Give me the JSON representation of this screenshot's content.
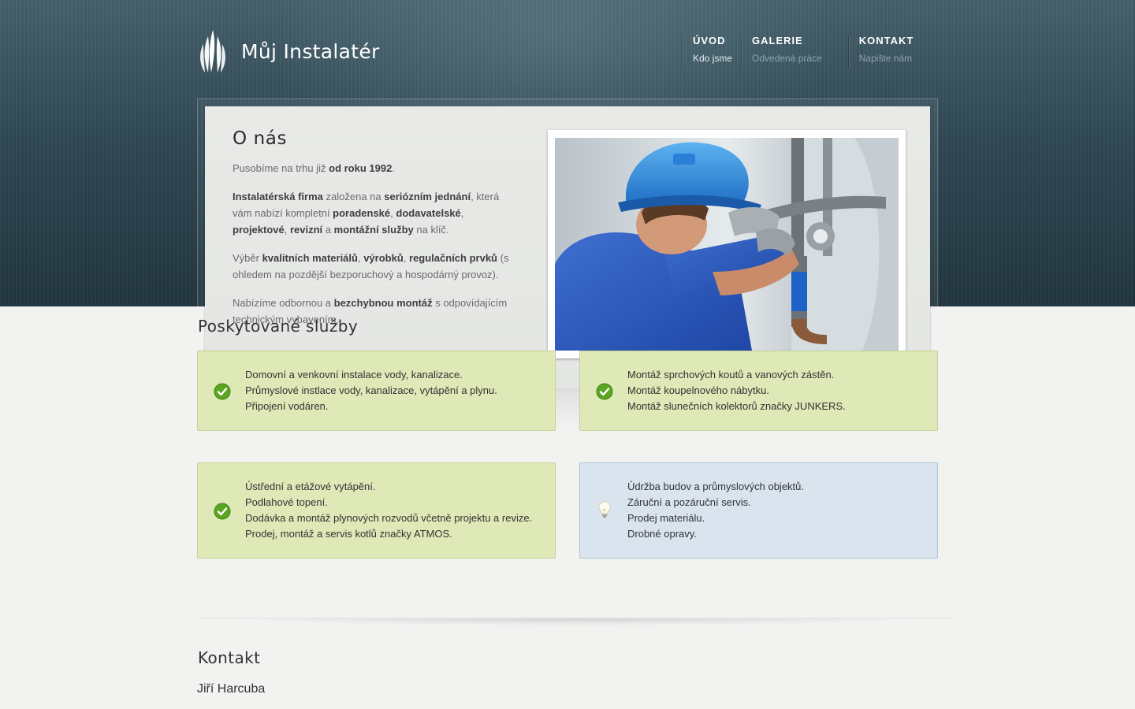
{
  "header": {
    "logo_text": "Můj Instalatér",
    "nav": [
      {
        "title": "ÚVOD",
        "sub": "Kdo jsme"
      },
      {
        "title": "GALERIE",
        "sub": "Odvedená práce"
      },
      {
        "title": "KONTAKT",
        "sub": "Napište nám"
      }
    ]
  },
  "about": {
    "title": "O nás",
    "p1": {
      "t1": "Pusobíme na trhu již ",
      "b1": "od roku 1992",
      "t2": "."
    },
    "p2": {
      "b1": "Instalatérská firma",
      "t1": " založena na ",
      "b2": "seriózním jednání",
      "t2": ", která vám nabízí kompletní ",
      "b3": "poradenské",
      "t3": ", ",
      "b4": "dodavatelské",
      "t4": ", ",
      "b5": "projektové",
      "t5": ", ",
      "b6": "revizní",
      "t6": " a ",
      "b7": "montážní služby",
      "t7": " na klíč."
    },
    "p3": {
      "t0": "Výběr ",
      "b1": "kvalitních materiálů",
      "t1": ", ",
      "b2": "výrobků",
      "t2": ", ",
      "b3": "regulačních prvků",
      "t3": " (s ohledem na pozdější bezporuchový a hospodárný provoz)."
    },
    "p4": {
      "t1": "Nabízíme odbornou a ",
      "b1": "bezchybnou montáž",
      "t2": " s odpovídajícím technickým vybavením."
    }
  },
  "services": {
    "title": "Poskytované služby",
    "boxes": [
      {
        "icon": "checkmark-icon",
        "lines": [
          "Domovní a venkovní instalace vody, kanalizace.",
          "Průmyslové instlace vody, kanalizace, vytápění a plynu.",
          "Připojení vodáren."
        ]
      },
      {
        "icon": "checkmark-icon",
        "lines": [
          "Montáž sprchových koutů a vanových zástěn.",
          "Montáž koupelnového nábytku.",
          "Montáž slunečních kolektorů značky JUNKERS."
        ]
      },
      {
        "icon": "checkmark-icon",
        "lines": [
          "Ústřední a etážové vytápění.",
          "Podlahové topení.",
          "Dodávka a montáž plynových rozvodů včetně projektu a revize.",
          "Prodej, montáž a servis kotlů značky ATMOS."
        ]
      },
      {
        "icon": "lightbulb-icon",
        "lines": [
          "Údržba budov a průmyslových objektů.",
          "Záruční a pozáruční servis.",
          "Prodej materiálu.",
          "Drobné opravy."
        ]
      }
    ]
  },
  "contact": {
    "title": "Kontakt",
    "name": "Jiří Harcuba"
  },
  "colors": {
    "header_dark": "#22363f",
    "green_box": "#dfe8b7",
    "blue_box": "#d9e4ef",
    "check_green": "#5aa522"
  }
}
